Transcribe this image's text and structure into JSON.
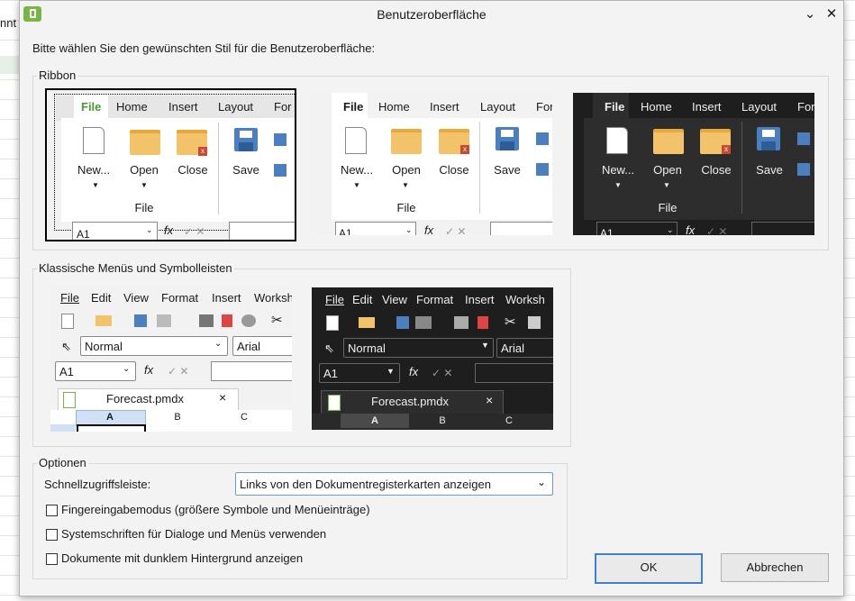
{
  "background": {
    "partial_text": "nnt"
  },
  "window": {
    "title": "Benutzeroberfläche",
    "minimize_glyph": "⌄",
    "close_glyph": "✕"
  },
  "intro": "Bitte wählen Sie den gewünschten Stil für die Benutzeroberfläche:",
  "ribbon": {
    "group_label": "Ribbon",
    "tabs": [
      "File",
      "Home",
      "Insert",
      "Layout",
      "For"
    ],
    "buttons": {
      "new": "New...",
      "open": "Open",
      "close": "Close",
      "save": "Save"
    },
    "group_caption": "File",
    "cell_ref": "A1",
    "fx": "fx",
    "accent": "#4a9a2f"
  },
  "classic": {
    "group_label": "Klassische Menüs und Symbolleisten",
    "menu": [
      "File",
      "Edit",
      "View",
      "Format",
      "Insert",
      "Worksh"
    ],
    "style_value": "Normal",
    "font_value": "Arial",
    "cell_ref": "A1",
    "fx": "fx",
    "doc_tab": "Forecast.pmdx",
    "doc_tab_close": "×",
    "columns": [
      "A",
      "B",
      "C"
    ]
  },
  "options": {
    "group_label": "Optionen",
    "quick_access_label": "Schnellzugriffsleiste:",
    "quick_access_value": "Links von den Dokumentregisterkarten anzeigen",
    "checkboxes": [
      "Fingereingabemodus (größere Symbole und Menüeinträge)",
      "Systemschriften für Dialoge und Menüs verwenden",
      "Dokumente mit dunklem Hintergrund anzeigen"
    ]
  },
  "buttons": {
    "ok": "OK",
    "cancel": "Abbrechen"
  }
}
